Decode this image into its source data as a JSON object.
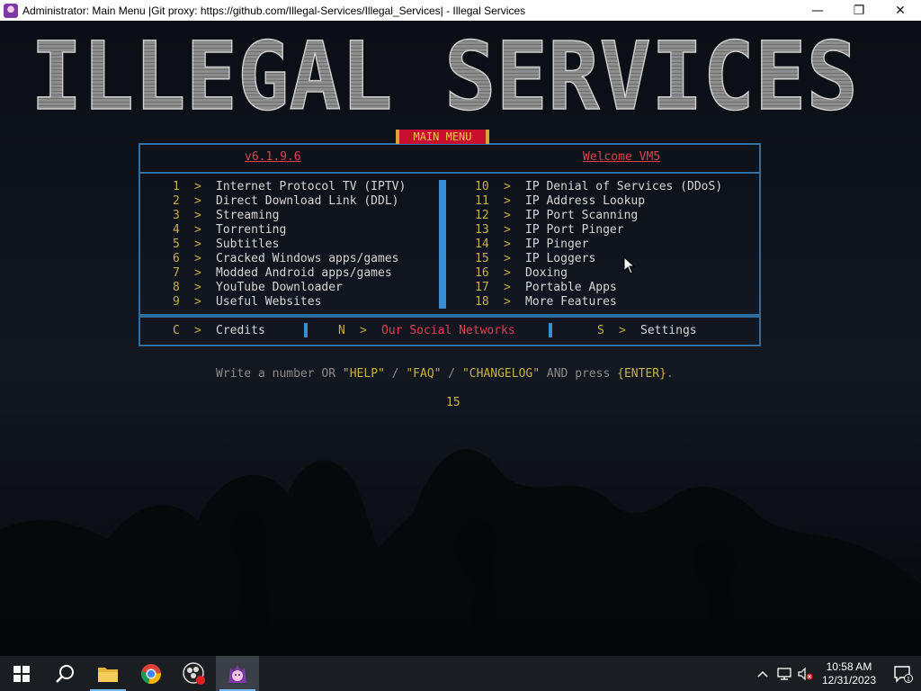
{
  "window": {
    "title": "Administrator:  Main Menu |Git proxy: https://github.com/Illegal-Services/Illegal_Services| - Illegal Services",
    "controls": {
      "minimize": "—",
      "maximize": "❐",
      "close": "✕"
    }
  },
  "banner": {
    "text": "ILLEGAL SERVICES"
  },
  "header": {
    "version": "v6.1.9.6",
    "menu_title": "MAIN MENU",
    "welcome": "Welcome VM5"
  },
  "menu": {
    "left": [
      {
        "num": "1",
        "label": "Internet Protocol TV (IPTV)"
      },
      {
        "num": "2",
        "label": "Direct Download Link (DDL)"
      },
      {
        "num": "3",
        "label": "Streaming"
      },
      {
        "num": "4",
        "label": "Torrenting"
      },
      {
        "num": "5",
        "label": "Subtitles"
      },
      {
        "num": "6",
        "label": "Cracked Windows apps/games"
      },
      {
        "num": "7",
        "label": "Modded Android apps/games"
      },
      {
        "num": "8",
        "label": "YouTube Downloader"
      },
      {
        "num": "9",
        "label": "Useful Websites"
      }
    ],
    "right": [
      {
        "num": "10",
        "label": "IP Denial of Services (DDoS)"
      },
      {
        "num": "11",
        "label": "IP Address Lookup"
      },
      {
        "num": "12",
        "label": "IP Port Scanning"
      },
      {
        "num": "13",
        "label": "IP Port Pinger"
      },
      {
        "num": "14",
        "label": "IP Pinger"
      },
      {
        "num": "15",
        "label": "IP Loggers"
      },
      {
        "num": "16",
        "label": "Doxing"
      },
      {
        "num": "17",
        "label": "Portable Apps"
      },
      {
        "num": "18",
        "label": "More Features"
      }
    ],
    "arrow": ">"
  },
  "footer": {
    "credits": {
      "key": "C",
      "label": "Credits"
    },
    "social": {
      "key": "N",
      "label": "Our Social Networks"
    },
    "settings": {
      "key": "S",
      "label": "Settings"
    }
  },
  "prompt": {
    "part1": "Write a number OR ",
    "help": "\"HELP\"",
    "sep1": " / ",
    "faq": "\"FAQ\"",
    "sep2": " / ",
    "changelog": "\"CHANGELOG\"",
    "part2": " AND press ",
    "enter": "{ENTER}",
    "end": "."
  },
  "input": {
    "value": "15"
  },
  "taskbar": {
    "items": [
      "windows-start",
      "search",
      "file-explorer",
      "chrome",
      "obs-studio",
      "illegal-services"
    ],
    "clock": {
      "time": "10:58 AM",
      "date": "12/31/2023"
    },
    "notification_count": "1"
  },
  "colors": {
    "accent_red": "#e04050",
    "accent_yellow": "#c8b044",
    "border_blue": "#2d6fa3",
    "divider_blue": "#3a8fd4",
    "text": "#d6d6d6"
  }
}
